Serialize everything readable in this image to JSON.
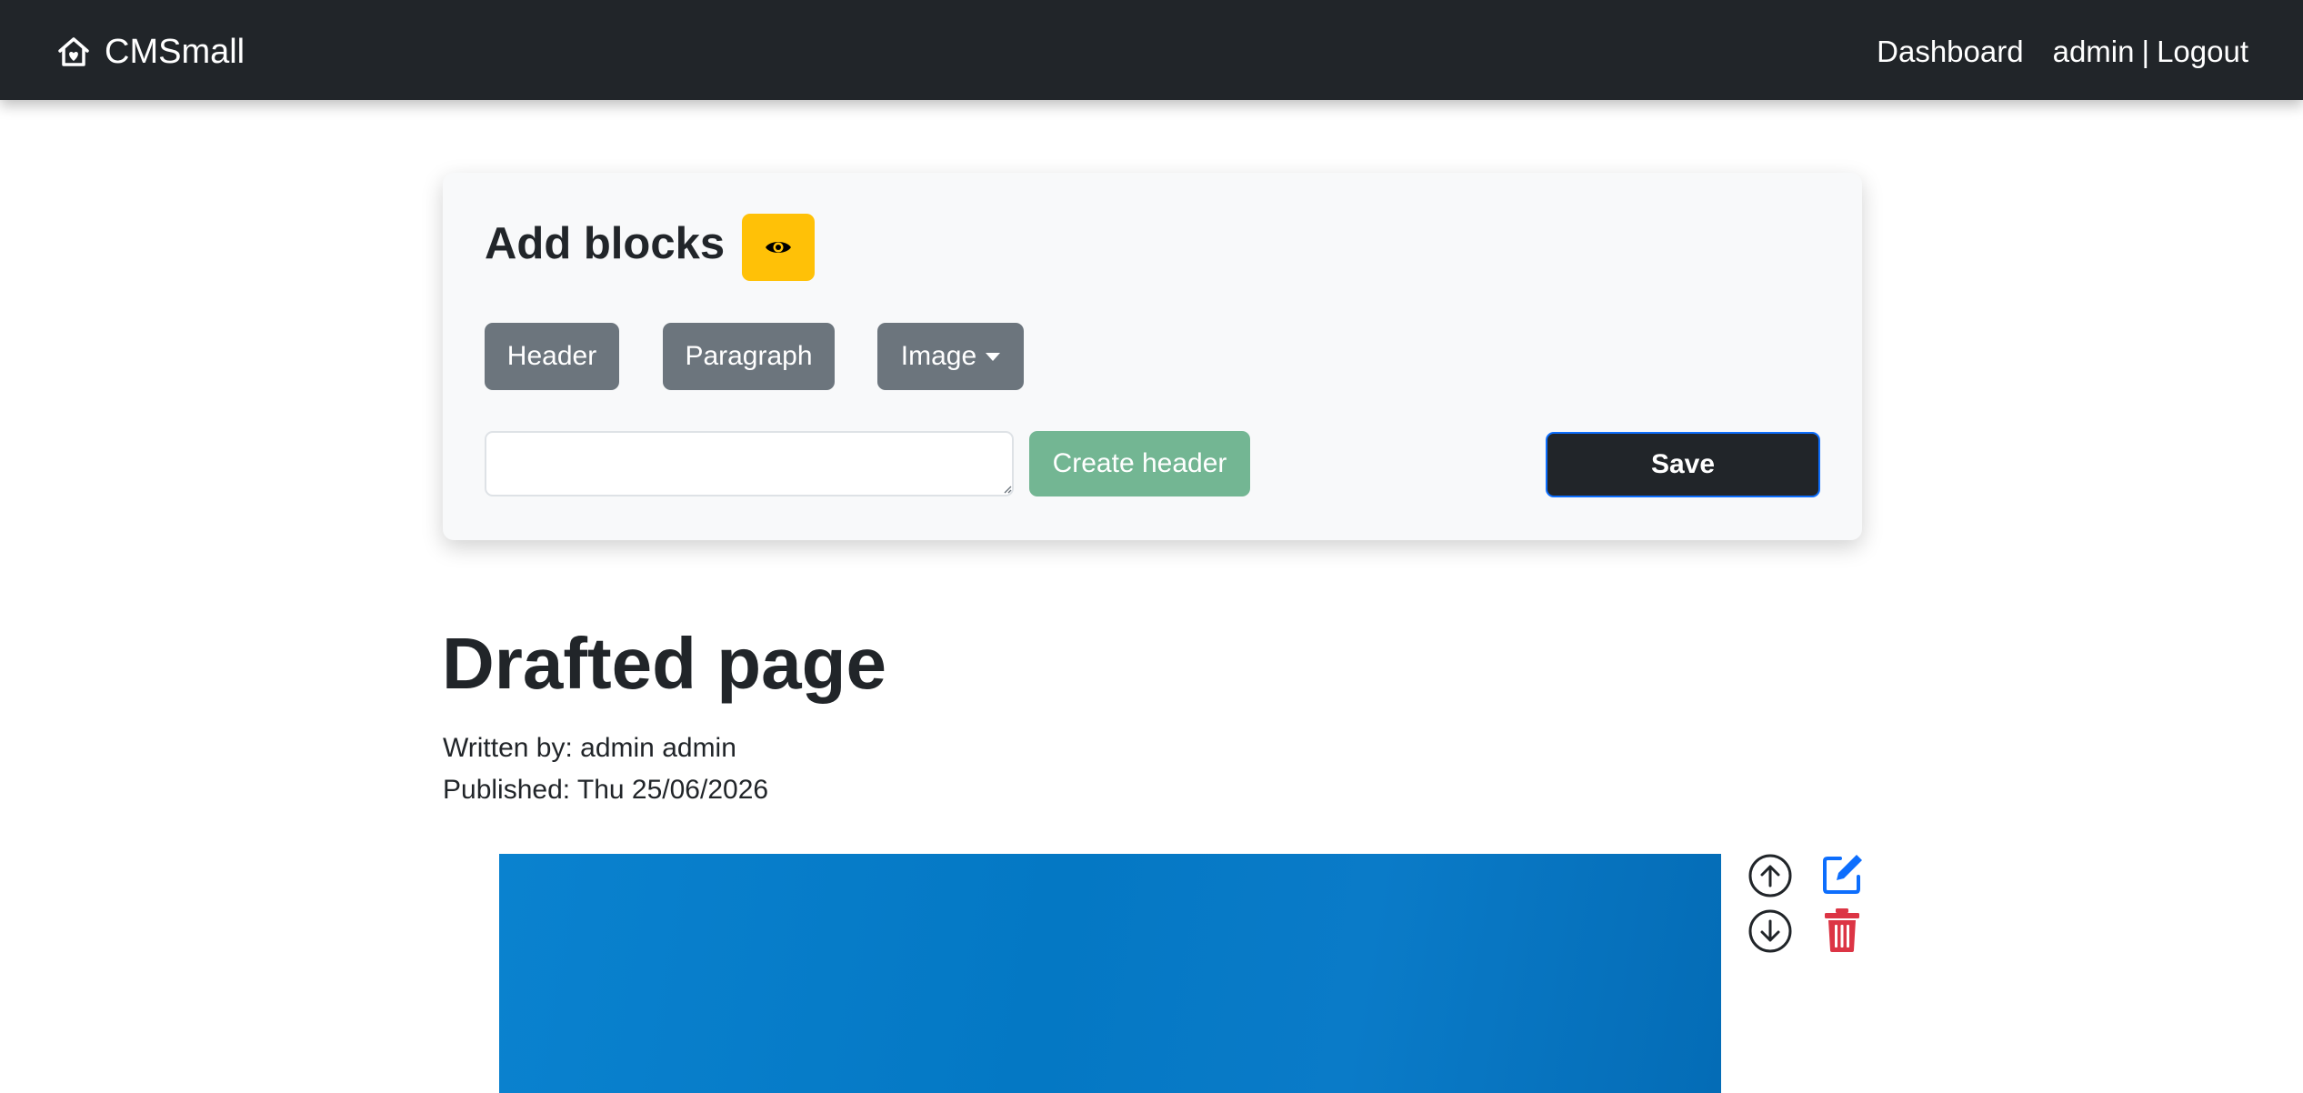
{
  "navbar": {
    "brand_icon": "house-heart-icon",
    "brand": "CMSmall",
    "dashboard_link": "Dashboard",
    "user_link": "admin",
    "separator": "|",
    "logout_link": "Logout"
  },
  "blocks_panel": {
    "title": "Add blocks",
    "preview_icon": "eye-icon",
    "preview_color": "#ffc107",
    "buttons": {
      "header": "Header",
      "paragraph": "Paragraph",
      "image": "Image"
    },
    "header_input": {
      "value": "",
      "placeholder": ""
    },
    "create_header": "Create header",
    "save": "Save"
  },
  "page": {
    "title": "Drafted page",
    "author_line": "Written by: admin admin",
    "published_line": "Published: Thu 25/06/2026"
  },
  "block_controls": {
    "move_up_icon": "arrow-up-circle-icon",
    "move_down_icon": "arrow-down-circle-icon",
    "edit_icon": "edit-square-icon",
    "delete_icon": "trash-icon",
    "edit_color": "#0d6efd",
    "delete_color": "#dc3545"
  }
}
